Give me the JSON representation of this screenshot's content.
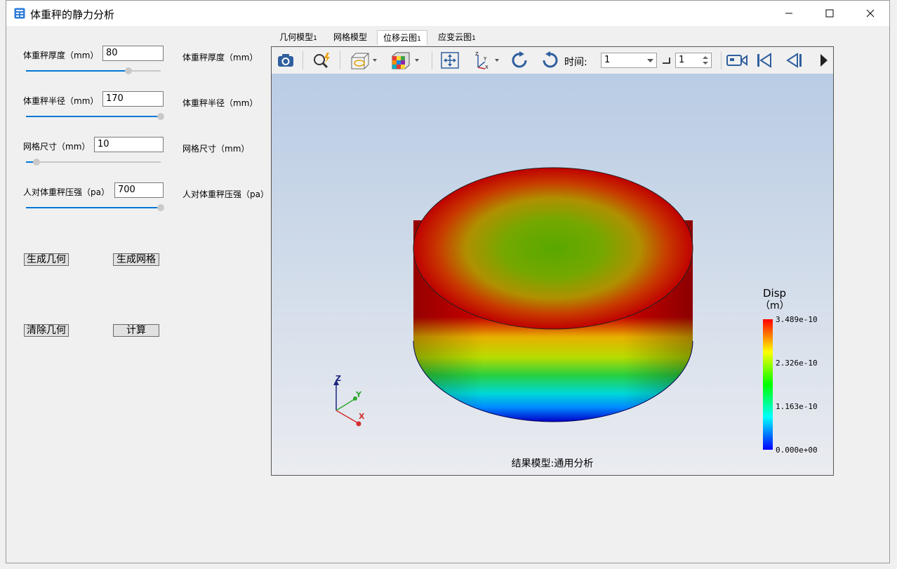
{
  "window": {
    "title": "体重秤的静力分析"
  },
  "params": [
    {
      "label": "体重秤厚度（mm）",
      "value": "80",
      "slider": 0.76,
      "echo": "体重秤厚度（mm）"
    },
    {
      "label": "体重秤半径（mm）",
      "value": "170",
      "slider": 1.0,
      "echo": "体重秤半径（mm）"
    },
    {
      "label": "网格尺寸（mm）",
      "value": "10",
      "slider": 0.08,
      "echo": "网格尺寸（mm）"
    },
    {
      "label": "人对体重秤压强（pa）",
      "value": "700",
      "slider": 1.0,
      "echo": "人对体重秤压强（pa）"
    }
  ],
  "buttons": {
    "gen_geom": "生成几何",
    "gen_mesh": "生成网格",
    "clear_geom": "清除几何",
    "compute": "计算"
  },
  "tabs": [
    "几何模型",
    "网格模型",
    "位移云图",
    "应变云图"
  ],
  "tab_suffix": "1",
  "active_tab": 2,
  "toolbar": {
    "time_label": "时间:",
    "time_value": "1",
    "step_value": "1",
    "icons": [
      "camera-icon",
      "zoom-icon",
      "view-cube-icon",
      "colormap-icon",
      "fit-icon",
      "axes-icon",
      "rotate-cw-icon",
      "rotate-ccw-icon",
      "record-icon",
      "first-frame-icon",
      "prev-frame-icon",
      "next-icon"
    ]
  },
  "legend": {
    "title": "Disp",
    "unit": "（m）",
    "ticks": [
      "3.489e-10",
      "2.326e-10",
      "1.163e-10",
      "0.000e+00"
    ],
    "colors": [
      "#ff0000",
      "#ffff00",
      "#00ff00",
      "#00ffff",
      "#0000ff"
    ]
  },
  "axes": {
    "z": "Z",
    "y": "Y",
    "x": "X"
  },
  "footer": "结果模型:通用分析"
}
